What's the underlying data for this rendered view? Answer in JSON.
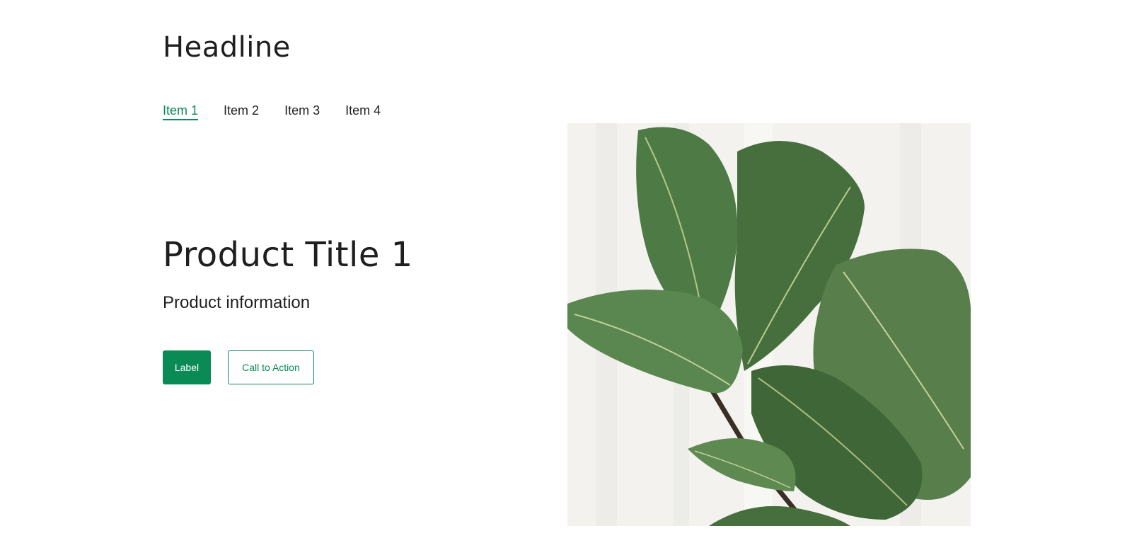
{
  "headline": "Headline",
  "tabs": [
    {
      "label": "Item 1",
      "active": true
    },
    {
      "label": "Item 2",
      "active": false
    },
    {
      "label": "Item 3",
      "active": false
    },
    {
      "label": "Item 4",
      "active": false
    }
  ],
  "product": {
    "title": "Product Title 1",
    "info": "Product information"
  },
  "buttons": {
    "primary_label": "Label",
    "secondary_label": "Call to Action"
  },
  "image": {
    "subject": "fiddle-leaf fig plant leaves"
  },
  "colors": {
    "accent": "#0a8a55",
    "text": "#1f1f1f",
    "background": "#ffffff"
  }
}
